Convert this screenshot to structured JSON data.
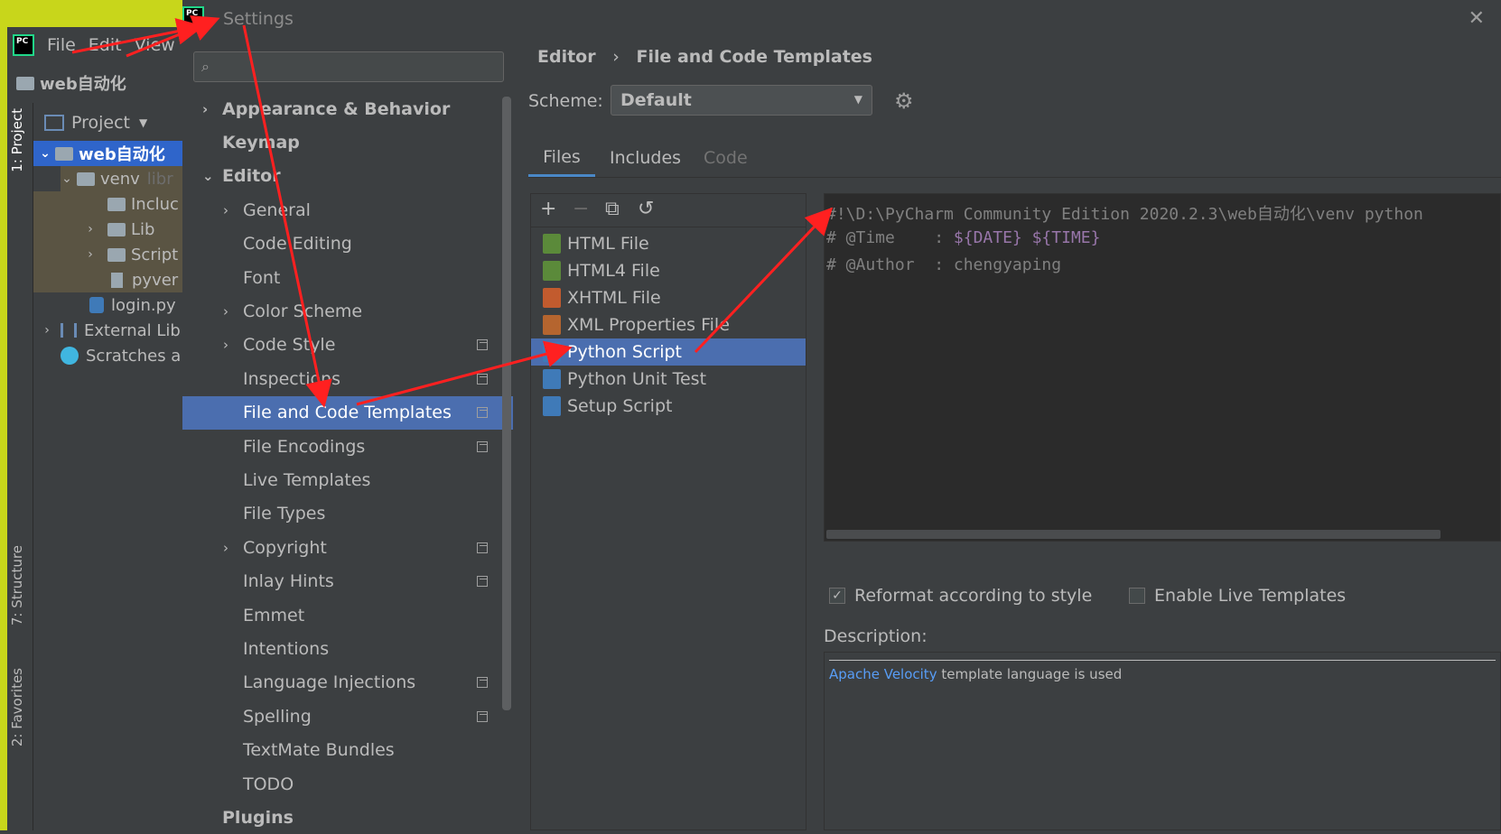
{
  "bg_ide": {
    "menu": [
      "File",
      "Edit",
      "View"
    ],
    "project_crumb": "web自动化",
    "project_dropdown": "Project",
    "side_tabs": [
      "1: Project",
      "7: Structure",
      "2: Favorites"
    ],
    "tree": [
      {
        "label": "web自动化",
        "bold": true
      },
      {
        "label": "venv",
        "suffix": "libr"
      },
      {
        "label": "Incluc"
      },
      {
        "label": "Lib"
      },
      {
        "label": "Script"
      },
      {
        "label": "pyver"
      },
      {
        "label": "login.py"
      },
      {
        "label": "External Lib"
      },
      {
        "label": "Scratches ar"
      }
    ]
  },
  "dialog": {
    "title": "Settings",
    "close_glyph": "✕",
    "search_placeholder": "",
    "nav": [
      {
        "label": "Appearance & Behavior",
        "level": 0,
        "chevron": "›"
      },
      {
        "label": "Keymap",
        "level": 0
      },
      {
        "label": "Editor",
        "level": 0,
        "chevron": "⌄"
      },
      {
        "label": "General",
        "level": 1,
        "chevron": "›"
      },
      {
        "label": "Code Editing",
        "level": 1
      },
      {
        "label": "Font",
        "level": 1
      },
      {
        "label": "Color Scheme",
        "level": 1,
        "chevron": "›"
      },
      {
        "label": "Code Style",
        "level": 1,
        "chevron": "›",
        "copy": true
      },
      {
        "label": "Inspections",
        "level": 1,
        "copy": true
      },
      {
        "label": "File and Code Templates",
        "level": 1,
        "copy": true,
        "selected": true
      },
      {
        "label": "File Encodings",
        "level": 1,
        "copy": true
      },
      {
        "label": "Live Templates",
        "level": 1
      },
      {
        "label": "File Types",
        "level": 1
      },
      {
        "label": "Copyright",
        "level": 1,
        "chevron": "›",
        "copy": true
      },
      {
        "label": "Inlay Hints",
        "level": 1,
        "copy": true
      },
      {
        "label": "Emmet",
        "level": 1
      },
      {
        "label": "Intentions",
        "level": 1
      },
      {
        "label": "Language Injections",
        "level": 1,
        "copy": true
      },
      {
        "label": "Spelling",
        "level": 1,
        "copy": true
      },
      {
        "label": "TextMate Bundles",
        "level": 1
      },
      {
        "label": "TODO",
        "level": 1
      },
      {
        "label": "Plugins",
        "level": 0
      }
    ],
    "breadcrumb": [
      "Editor",
      "File and Code Templates"
    ],
    "breadcrumb_sep": "›",
    "scheme_label": "Scheme:",
    "scheme_value": "Default",
    "tabs": [
      {
        "label": "Files",
        "state": "active"
      },
      {
        "label": "Includes",
        "state": "normal"
      },
      {
        "label": "Code",
        "state": "disabled"
      }
    ],
    "toolbar": [
      "+",
      "−",
      "⧉",
      "↺"
    ],
    "templates": [
      {
        "label": "HTML File",
        "icon": "html-file-icon",
        "color": "#5b8a3a"
      },
      {
        "label": "HTML4 File",
        "icon": "html-file-icon",
        "color": "#5b8a3a"
      },
      {
        "label": "XHTML File",
        "icon": "xhtml-file-icon",
        "color": "#c25b2e"
      },
      {
        "label": "XML Properties File",
        "icon": "xml-file-icon",
        "color": "#b5652f"
      },
      {
        "label": "Python Script",
        "icon": "python-file-icon",
        "color": "#3f7ab8",
        "selected": true
      },
      {
        "label": "Python Unit Test",
        "icon": "python-file-icon",
        "color": "#3f7ab8"
      },
      {
        "label": "Setup Script",
        "icon": "python-file-icon",
        "color": "#3f7ab8"
      }
    ],
    "code_lines": [
      {
        "text": "#!\\D:\\PyCharm Community Edition 2020.2.3\\web自动化\\venv python"
      },
      {
        "prefix": "# @Time    : ",
        "var1": "${DATE}",
        "space": " ",
        "var2": "${TIME}"
      },
      {
        "text": "# @Author  : chengyaping"
      }
    ],
    "reformat_label": "Reformat according to style",
    "reformat_checked": "✓",
    "live_label": "Enable Live Templates",
    "description_label": "Description:",
    "description_link": "Apache Velocity",
    "description_text": " template language is used"
  },
  "colors": {
    "accent_selection": "#4b6eaf",
    "annotation_arrow": "#ff2020",
    "link": "#589df6",
    "template_var": "#9876aa"
  }
}
